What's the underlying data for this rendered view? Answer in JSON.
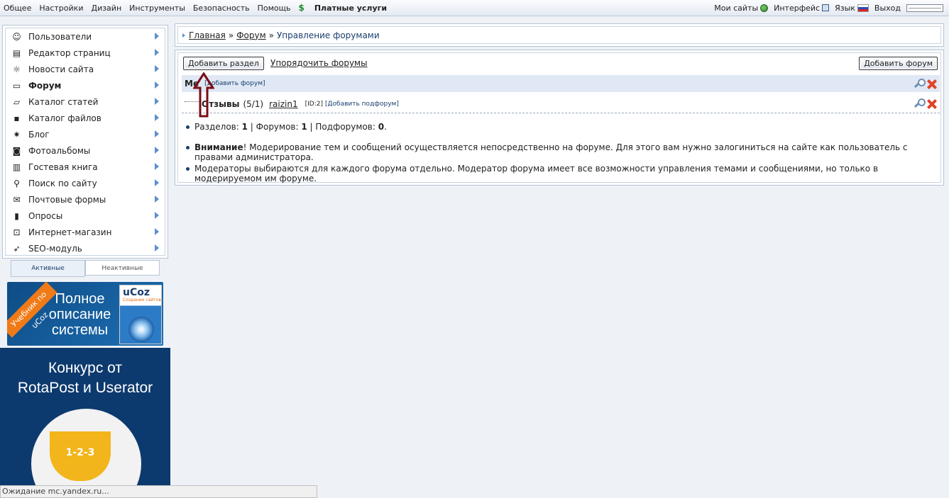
{
  "topbar": {
    "menu": [
      "Общее",
      "Настройки",
      "Дизайн",
      "Инструменты",
      "Безопасность",
      "Помощь"
    ],
    "paid": "Платные услуги",
    "my_sites": "Мои сайты",
    "interface": "Интерфейс",
    "language": "Язык",
    "logout": "Выход"
  },
  "sidebar": {
    "items": [
      {
        "label": "Пользователи",
        "icon": "user-icon"
      },
      {
        "label": "Редактор страниц",
        "icon": "page-icon"
      },
      {
        "label": "Новости сайта",
        "icon": "bulb-icon"
      },
      {
        "label": "Форум",
        "icon": "forum-icon",
        "active": true
      },
      {
        "label": "Каталог статей",
        "icon": "folder-icon"
      },
      {
        "label": "Каталог файлов",
        "icon": "disk-icon"
      },
      {
        "label": "Блог",
        "icon": "gear-icon"
      },
      {
        "label": "Фотоальбомы",
        "icon": "camera-icon"
      },
      {
        "label": "Гостевая книга",
        "icon": "book-icon"
      },
      {
        "label": "Поиск по сайту",
        "icon": "search-icon"
      },
      {
        "label": "Почтовые формы",
        "icon": "mail-icon"
      },
      {
        "label": "Опросы",
        "icon": "chart-icon"
      },
      {
        "label": "Интернет-магазин",
        "icon": "cart-icon"
      },
      {
        "label": "SEO-модуль",
        "icon": "rocket-icon"
      }
    ],
    "tab_active": "Активные",
    "tab_inactive": "Неактивные"
  },
  "banner1": {
    "ribbon": "Учебник по uCoz",
    "text": "Полное описание системы",
    "book_title": "uCoz",
    "book_sub": "Создание сайтов"
  },
  "banner2": {
    "title_line1": "Конкурс от",
    "title_line2": "RotaPost и Userator",
    "cup_text": "1-2-3"
  },
  "status_bar": "Ожидание mc.yandex.ru...",
  "breadcrumb": {
    "home": "Главная",
    "forum": "Форум",
    "current": "Управление форумами",
    "sep": "»"
  },
  "toolbar": {
    "add_section": "Добавить раздел",
    "order_forums": "Упорядочить форумы",
    "add_forum": "Добавить форум"
  },
  "section": {
    "name": "Ме",
    "add_forum_link": "[добавить форум]"
  },
  "forum": {
    "name": "Отзывы",
    "counts": "(5/1)",
    "user": "raizin1",
    "id": "[ID:2]",
    "add_subforum": "[Добавить подфорум]"
  },
  "stats": {
    "sections_label": "Разделов:",
    "sections": "1",
    "forums_label": "Форумов:",
    "forums": "1",
    "subforums_label": "Подфорумов:",
    "subforums": "0"
  },
  "notes": {
    "warning_bold": "Внимание",
    "warning_text": "! Модерирование тем и сообщений осуществляется непосредственно на форуме. Для этого вам нужно залогиниться на сайте как пользователь с правами администратора.",
    "moderators": "Модераторы выбираются для каждого форума отдельно. Модератор форума имеет все возможности управления темами и сообщениями, но только в модерируемом им форуме."
  },
  "colors": {
    "accent": "#1a3f6e",
    "arrow": "#7a0d16",
    "delete": "#e0442a"
  }
}
